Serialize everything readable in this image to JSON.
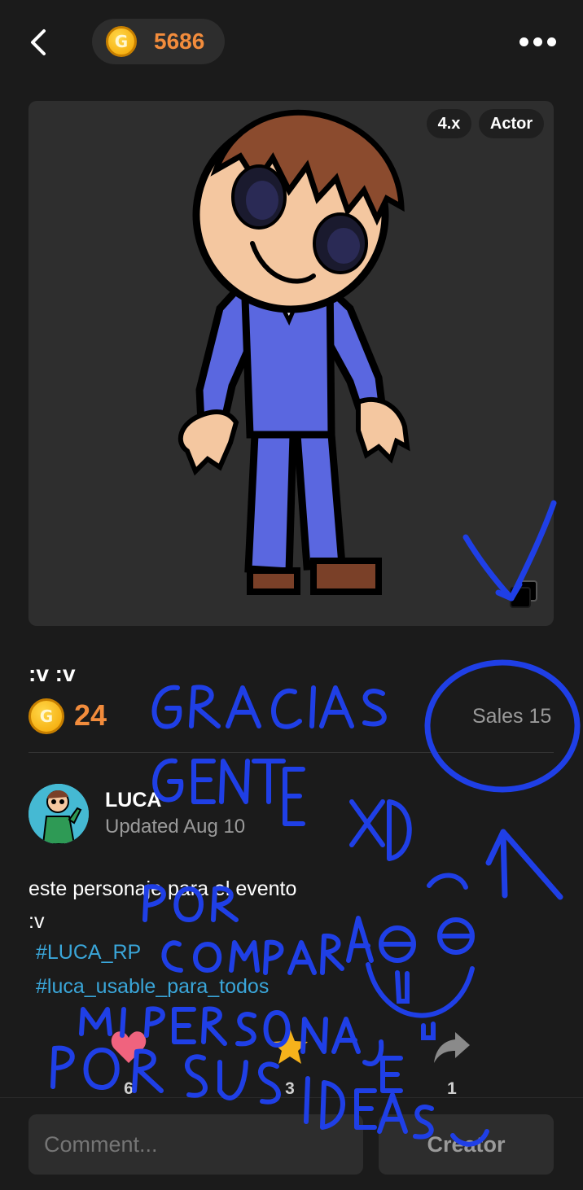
{
  "header": {
    "coin_balance": "5686"
  },
  "artwork": {
    "version_tag": "4.x",
    "type_tag": "Actor"
  },
  "item": {
    "title": ":v :v",
    "price": "24",
    "sales": "Sales 15"
  },
  "author": {
    "name": "LUCA",
    "updated": "Updated Aug 10"
  },
  "description": {
    "line1": "este personaje para el evento",
    "line2": ":v",
    "hashtags": [
      "#LUCA_RP",
      "#luca_usable_para_todos"
    ]
  },
  "stats": {
    "likes": "6",
    "favorites": "3",
    "shares": "1"
  },
  "footer": {
    "comment_placeholder": "Comment...",
    "creator_label": "Creator"
  },
  "colors": {
    "accent": "#f28c3c",
    "hashtag": "#3aa6d9",
    "scribble": "#1f3fe6",
    "like": "#f0637e",
    "favorite": "#f6b21b"
  },
  "icons": [
    "back-arrow-icon",
    "coin-icon",
    "more-dots-icon",
    "layers-icon",
    "heart-icon",
    "star-icon",
    "share-icon"
  ]
}
